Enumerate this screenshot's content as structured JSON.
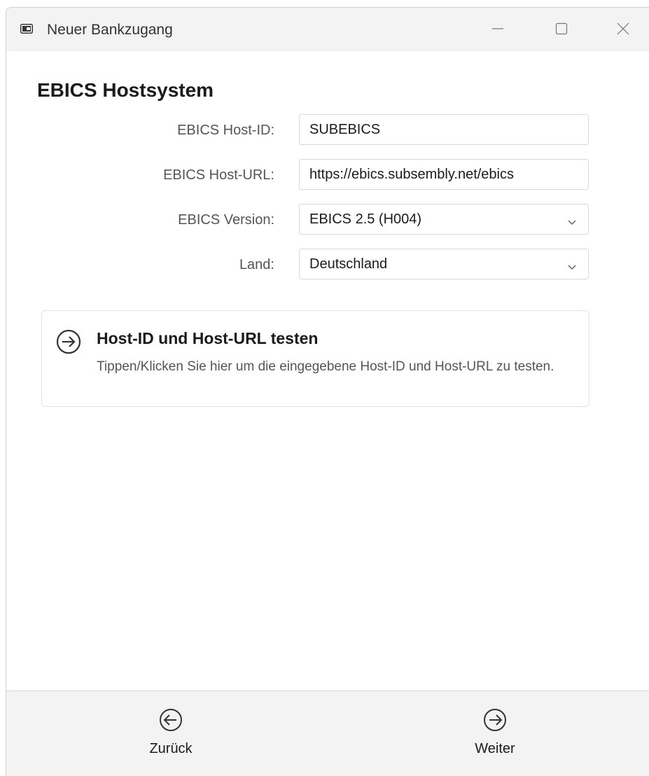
{
  "window": {
    "title": "Neuer Bankzugang",
    "icon": "card-icon",
    "controls": [
      "minimize-icon",
      "maximize-icon",
      "close-icon"
    ]
  },
  "section": {
    "title": "EBICS Hostsystem"
  },
  "form": {
    "host_id": {
      "label": "EBICS Host-ID:",
      "value": "SUBEBICS"
    },
    "host_url": {
      "label": "EBICS Host-URL:",
      "value": "https://ebics.subsembly.net/ebics"
    },
    "version": {
      "label": "EBICS Version:",
      "value": "EBICS 2.5 (H004)"
    },
    "country": {
      "label": "Land:",
      "value": "Deutschland"
    }
  },
  "test_action": {
    "title": "Host-ID und Host-URL testen",
    "description": "Tippen/Klicken Sie hier um die eingegebene Host-ID und Host-URL zu testen."
  },
  "footer": {
    "back_label": "Zurück",
    "next_label": "Weiter"
  }
}
